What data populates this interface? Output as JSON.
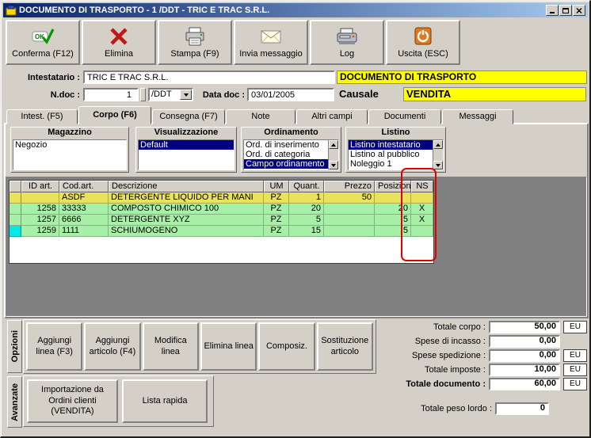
{
  "window": {
    "title": "DOCUMENTO DI TRASPORTO - 1 /DDT - TRIC E TRAC S.R.L."
  },
  "toolbar": {
    "buttons": [
      {
        "label": "Conferma (F12)",
        "icon": "ok-check-icon"
      },
      {
        "label": "Elimina",
        "icon": "red-x-icon"
      },
      {
        "label": "Stampa (F9)",
        "icon": "printer-icon"
      },
      {
        "label": "Invia messaggio",
        "icon": "envelope-icon"
      },
      {
        "label": "Log",
        "icon": "scanner-icon"
      },
      {
        "label": "Uscita (ESC)",
        "icon": "exit-power-icon"
      }
    ]
  },
  "header": {
    "intestatario_label": "Intestatario :",
    "intestatario_value": "TRIC E TRAC S.R.L.",
    "ndoc_label": "N.doc :",
    "ndoc_value": "1",
    "doc_type_value": "/DDT",
    "data_doc_label": "Data doc :",
    "data_doc_value": "03/01/2005",
    "banner_title": "DOCUMENTO DI TRASPORTO",
    "causale_label": "Causale",
    "causale_value": "VENDITA"
  },
  "tabs": [
    {
      "label": "Intest. (F5)"
    },
    {
      "label": "Corpo (F6)"
    },
    {
      "label": "Consegna (F7)"
    },
    {
      "label": "Note"
    },
    {
      "label": "Altri campi"
    },
    {
      "label": "Documenti"
    },
    {
      "label": "Messaggi"
    }
  ],
  "panels": {
    "magazzino": {
      "title": "Magazzino",
      "items": [
        {
          "label": "Negozio",
          "selected": false
        }
      ]
    },
    "visualizzazione": {
      "title": "Visualizzazione",
      "items": [
        {
          "label": "Default",
          "selected": true
        }
      ]
    },
    "ordinamento": {
      "title": "Ordinamento",
      "items": [
        {
          "label": "Ord. di inserimento",
          "selected": false
        },
        {
          "label": "Ord. di categoria",
          "selected": false
        },
        {
          "label": "Campo ordinamento",
          "selected": true
        }
      ]
    },
    "listino": {
      "title": "Listino",
      "items": [
        {
          "label": "Listino intestatario",
          "selected": true
        },
        {
          "label": "Listino al pubblico",
          "selected": false
        },
        {
          "label": "Noleggio 1",
          "selected": false
        }
      ]
    }
  },
  "grid": {
    "columns": [
      "ID art.",
      "Cod.art.",
      "Descrizione",
      "UM",
      "Quant.",
      "Prezzo",
      "Posizione",
      "NS"
    ],
    "rows": [
      {
        "id_art": "",
        "cod_art": "ASDF",
        "descrizione": "DETERGENTE LIQUIDO PER MANI",
        "um": "PZ",
        "quant": "1",
        "prezzo": "50",
        "posizione": "",
        "ns": ""
      },
      {
        "id_art": "1258",
        "cod_art": "33333",
        "descrizione": "COMPOSTO CHIMICO 100",
        "um": "PZ",
        "quant": "20",
        "prezzo": "",
        "posizione": "20",
        "ns": "X"
      },
      {
        "id_art": "1257",
        "cod_art": "6666",
        "descrizione": "DETERGENTE XYZ",
        "um": "PZ",
        "quant": "5",
        "prezzo": "",
        "posizione": "5",
        "ns": "X"
      },
      {
        "id_art": "1259",
        "cod_art": "1111",
        "descrizione": "SCHIUMOGENO",
        "um": "PZ",
        "quant": "15",
        "prezzo": "",
        "posizione": "5",
        "ns": ""
      }
    ]
  },
  "side_tabs": {
    "opzioni": "Opzioni",
    "avanzate": "Avanzate"
  },
  "actions": {
    "aggiungi_linea": "Aggiungi linea (F3)",
    "aggiungi_articolo": "Aggiungi articolo (F4)",
    "modifica_linea": "Modifica linea",
    "elimina_linea": "Elimina linea",
    "composiz": "Composiz.",
    "sostituzione": "Sostituzione articolo",
    "importazione": "Importazione da Ordini clienti (VENDITA)",
    "lista_rapida": "Lista rapida"
  },
  "totals": {
    "rows": [
      {
        "label": "Totale corpo :",
        "value": "50,00",
        "currency": "EU"
      },
      {
        "label": "Spese di incasso :",
        "value": "0,00",
        "currency": ""
      },
      {
        "label": "Spese spedizione :",
        "value": "0,00",
        "currency": "EU"
      },
      {
        "label": "Totale imposte :",
        "value": "10,00",
        "currency": "EU"
      },
      {
        "label": "Totale documento :",
        "value": "60,00",
        "currency": "EU"
      }
    ],
    "peso_lordo_label": "Totale peso lordo :",
    "peso_lordo_value": "0"
  },
  "colors": {
    "accent_yellow": "#ffff00",
    "row_yellow": "#e8e25c",
    "row_green": "#a8f0a8",
    "row_cyan": "#00e8e8",
    "selection_navy": "#000080",
    "annotation_red": "#e00000",
    "dark_panel": "#808080"
  }
}
